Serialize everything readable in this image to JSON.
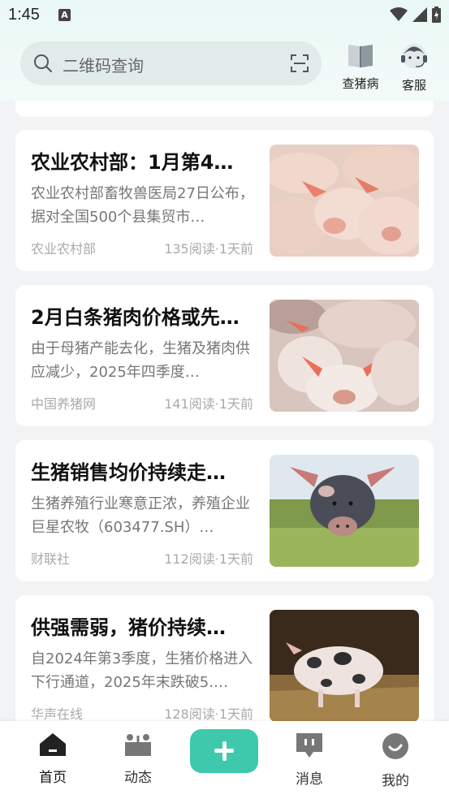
{
  "status_bar": {
    "time": "1:45",
    "notification_icon": "A"
  },
  "search": {
    "placeholder": "二维码查询"
  },
  "header_actions": [
    {
      "label": "查猪病",
      "icon": "book-icon"
    },
    {
      "label": "客服",
      "icon": "customer-service-icon"
    }
  ],
  "articles": [
    {
      "title": "农业农村部：1月第4…",
      "desc": "农业农村部畜牧兽医局27日公布，据对全国500个县集贸市…",
      "source": "农业农村部",
      "meta": "135阅读·1天前",
      "image": "piglets-group"
    },
    {
      "title": "2月白条猪肉价格或先…",
      "desc": "由于母猪产能去化，生猪及猪肉供应减少，2025年四季度…",
      "source": "中国养猪网",
      "meta": "141阅读·1天前",
      "image": "piglets-closeup"
    },
    {
      "title": "生猪销售均价持续走…",
      "desc": "生猪养殖行业寒意正浓，养殖企业巨星农牧（603477.SH）…",
      "source": "财联社",
      "meta": "112阅读·1天前",
      "image": "spotted-pig-field"
    },
    {
      "title": "供强需弱，猪价持续…",
      "desc": "自2024年第3季度，生猪价格进入下行通道，2025年末跌破5.…",
      "source": "华声在线",
      "meta": "128阅读·1天前",
      "image": "spotted-piglet-straw"
    }
  ],
  "bottom_nav": [
    {
      "label": "首页",
      "active": true
    },
    {
      "label": "动态"
    },
    {
      "label": "+"
    },
    {
      "label": "消息"
    },
    {
      "label": "我的"
    }
  ],
  "colors": {
    "accent": "#3ec9ad",
    "header_bg": "#eaf8f5"
  }
}
